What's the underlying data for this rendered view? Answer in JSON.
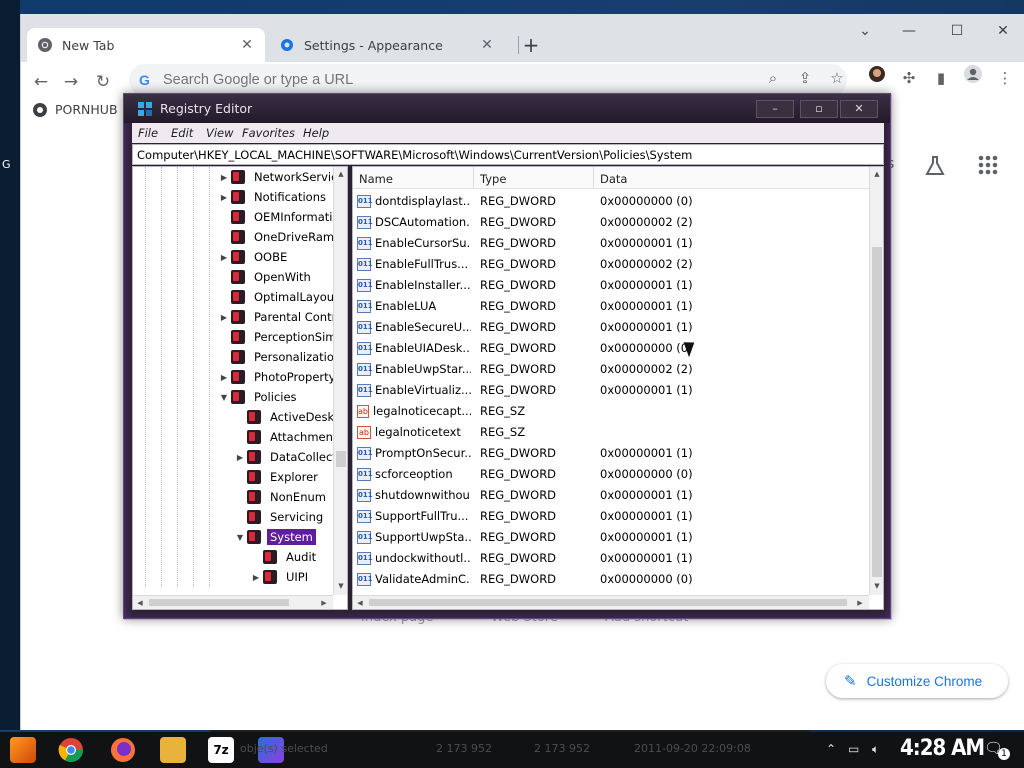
{
  "chrome": {
    "tabs": [
      {
        "title": "New Tab",
        "active": true
      },
      {
        "title": "Settings - Appearance",
        "active": false
      }
    ],
    "omnibox_placeholder": "Search Google or type a URL",
    "bookmark": "PORNHUB",
    "customize_label": "Customize Chrome",
    "shortcut_labels": [
      "Index page",
      "Web Store",
      "Add shortcut"
    ],
    "left_edge_letter": "G",
    "lab_letter": "s"
  },
  "regedit": {
    "title": "Registry Editor",
    "menus": [
      "File",
      "Edit",
      "View",
      "Favorites",
      "Help"
    ],
    "address": "Computer\\HKEY_LOCAL_MACHINE\\SOFTWARE\\Microsoft\\Windows\\CurrentVersion\\Policies\\System",
    "tree": [
      {
        "label": "NetworkServic",
        "depth": 0,
        "twisty": "right"
      },
      {
        "label": "Notifications",
        "depth": 0,
        "twisty": "right"
      },
      {
        "label": "OEMInformati",
        "depth": 0,
        "twisty": ""
      },
      {
        "label": "OneDriveRamp",
        "depth": 0,
        "twisty": ""
      },
      {
        "label": "OOBE",
        "depth": 0,
        "twisty": "right"
      },
      {
        "label": "OpenWith",
        "depth": 0,
        "twisty": ""
      },
      {
        "label": "OptimalLayout",
        "depth": 0,
        "twisty": ""
      },
      {
        "label": "Parental Contro",
        "depth": 0,
        "twisty": "right"
      },
      {
        "label": "PerceptionSim",
        "depth": 0,
        "twisty": ""
      },
      {
        "label": "Personalization",
        "depth": 0,
        "twisty": ""
      },
      {
        "label": "PhotoPropertyH",
        "depth": 0,
        "twisty": "right"
      },
      {
        "label": "Policies",
        "depth": 0,
        "twisty": "down"
      },
      {
        "label": "ActiveDesk",
        "depth": 1,
        "twisty": ""
      },
      {
        "label": "Attachments",
        "depth": 1,
        "twisty": ""
      },
      {
        "label": "DataCollect",
        "depth": 1,
        "twisty": "right"
      },
      {
        "label": "Explorer",
        "depth": 1,
        "twisty": ""
      },
      {
        "label": "NonEnum",
        "depth": 1,
        "twisty": ""
      },
      {
        "label": "Servicing",
        "depth": 1,
        "twisty": ""
      },
      {
        "label": "System",
        "depth": 1,
        "twisty": "down",
        "selected": true
      },
      {
        "label": "Audit",
        "depth": 2,
        "twisty": ""
      },
      {
        "label": "UIPI",
        "depth": 2,
        "twisty": "right"
      }
    ],
    "columns": [
      "Name",
      "Type",
      "Data"
    ],
    "values": [
      {
        "name": "dontdisplaylast...",
        "type": "REG_DWORD",
        "data": "0x00000000 (0)",
        "kind": "dword"
      },
      {
        "name": "DSCAutomation...",
        "type": "REG_DWORD",
        "data": "0x00000002 (2)",
        "kind": "dword"
      },
      {
        "name": "EnableCursorSu...",
        "type": "REG_DWORD",
        "data": "0x00000001 (1)",
        "kind": "dword"
      },
      {
        "name": "EnableFullTrus...",
        "type": "REG_DWORD",
        "data": "0x00000002 (2)",
        "kind": "dword"
      },
      {
        "name": "EnableInstaller...",
        "type": "REG_DWORD",
        "data": "0x00000001 (1)",
        "kind": "dword"
      },
      {
        "name": "EnableLUA",
        "type": "REG_DWORD",
        "data": "0x00000001 (1)",
        "kind": "dword"
      },
      {
        "name": "EnableSecureU...",
        "type": "REG_DWORD",
        "data": "0x00000001 (1)",
        "kind": "dword"
      },
      {
        "name": "EnableUIADesk...",
        "type": "REG_DWORD",
        "data": "0x00000000 (0)",
        "kind": "dword"
      },
      {
        "name": "EnableUwpStar...",
        "type": "REG_DWORD",
        "data": "0x00000002 (2)",
        "kind": "dword"
      },
      {
        "name": "EnableVirtualiz...",
        "type": "REG_DWORD",
        "data": "0x00000001 (1)",
        "kind": "dword"
      },
      {
        "name": "legalnoticecapt...",
        "type": "REG_SZ",
        "data": "",
        "kind": "sz"
      },
      {
        "name": "legalnoticetext",
        "type": "REG_SZ",
        "data": "",
        "kind": "sz"
      },
      {
        "name": "PromptOnSecur...",
        "type": "REG_DWORD",
        "data": "0x00000001 (1)",
        "kind": "dword"
      },
      {
        "name": "scforceoption",
        "type": "REG_DWORD",
        "data": "0x00000000 (0)",
        "kind": "dword"
      },
      {
        "name": "shutdownwithou...",
        "type": "REG_DWORD",
        "data": "0x00000001 (1)",
        "kind": "dword"
      },
      {
        "name": "SupportFullTru...",
        "type": "REG_DWORD",
        "data": "0x00000001 (1)",
        "kind": "dword"
      },
      {
        "name": "SupportUwpSta...",
        "type": "REG_DWORD",
        "data": "0x00000001 (1)",
        "kind": "dword"
      },
      {
        "name": "undockwithoutl...",
        "type": "REG_DWORD",
        "data": "0x00000001 (1)",
        "kind": "dword"
      },
      {
        "name": "ValidateAdminC...",
        "type": "REG_DWORD",
        "data": "0x00000000 (0)",
        "kind": "dword"
      }
    ]
  },
  "taskbar": {
    "ghost_status": [
      "obje(s) selected",
      "2 173 952",
      "2 173 952",
      "2011-09-20 22:09:08"
    ],
    "clock": "4:28 AM",
    "notification_count": "1",
    "app_7z_label": "7z"
  },
  "colors": {
    "selection": "#5f1f9c",
    "chrome_accent": "#1a73e8",
    "taskbar": "#111214"
  }
}
